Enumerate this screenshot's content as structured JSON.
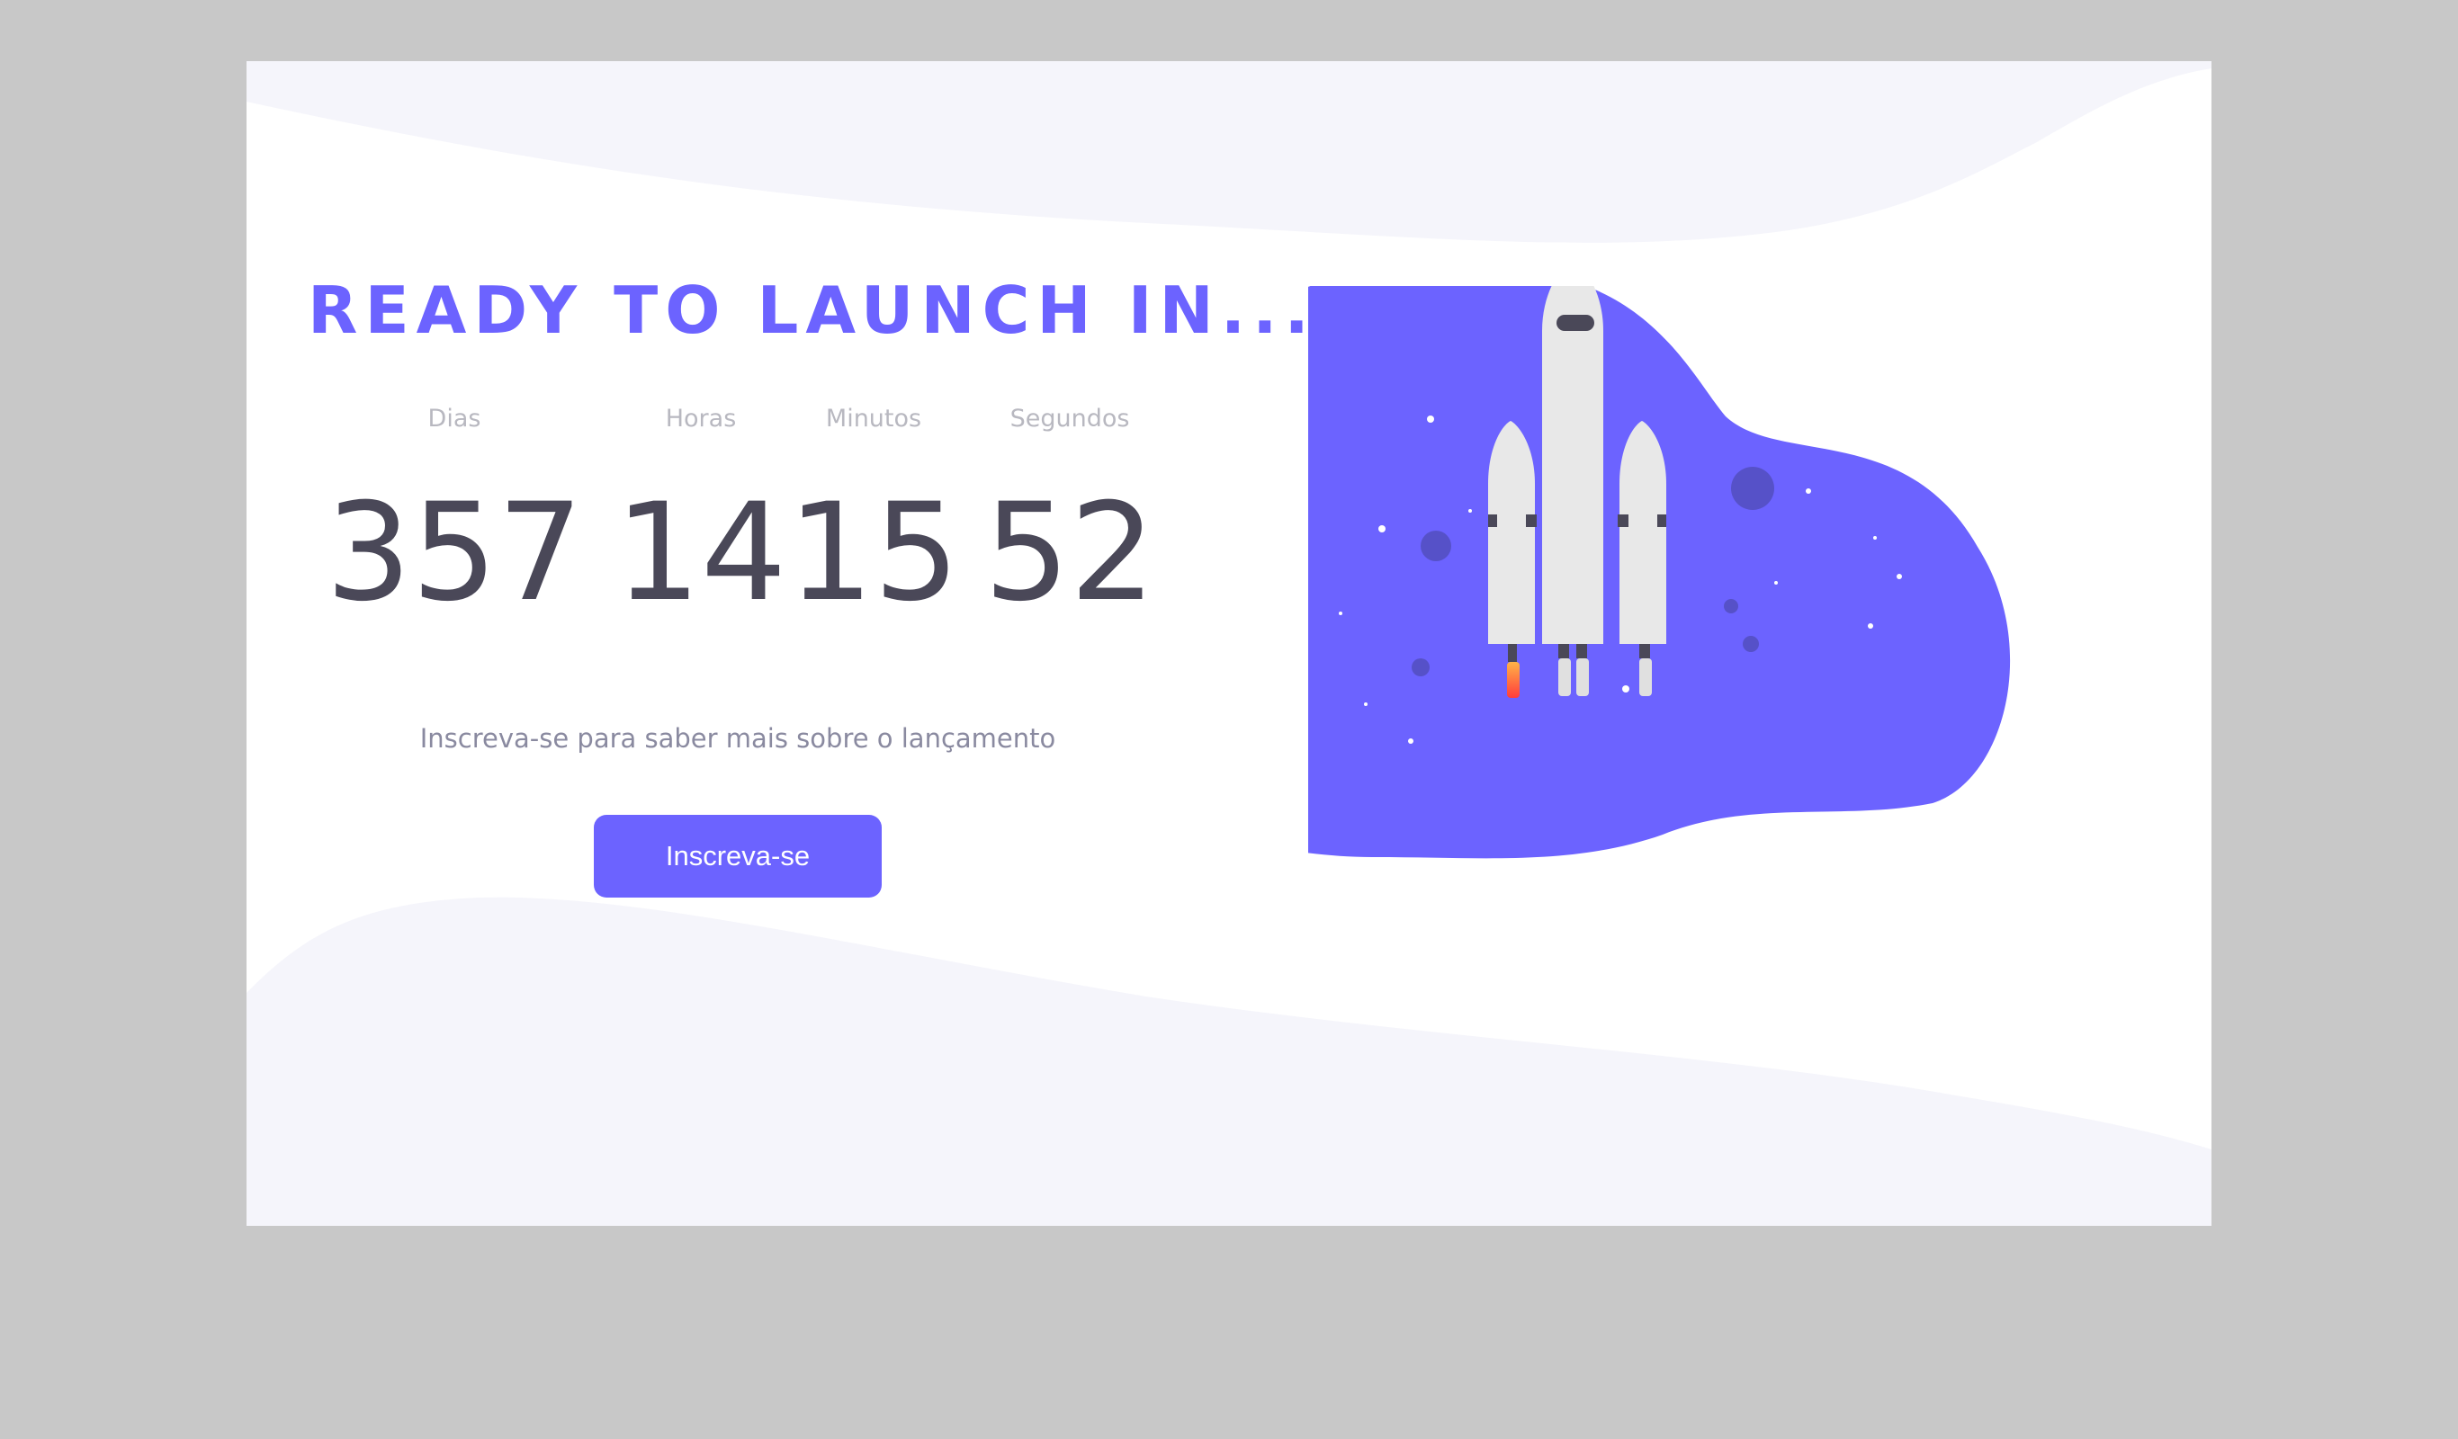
{
  "colors": {
    "accent": "#6c63ff",
    "text_dark": "#4a4858",
    "label_gray": "#b8b8c0",
    "wave": "#f5f5fb",
    "rocket_body": "#e8e8e8",
    "flame": "#ff5a3c"
  },
  "hero": {
    "title": "READY TO LAUNCH IN..."
  },
  "countdown": {
    "days": {
      "label": "Dias",
      "value": "357"
    },
    "hours": {
      "label": "Horas",
      "value": "14"
    },
    "minutes": {
      "label": "Minutos",
      "value": "15"
    },
    "seconds": {
      "label": "Segundos",
      "value": "52"
    }
  },
  "cta": {
    "text": "Inscreva-se para saber mais sobre o lançamento",
    "button_label": "Inscreva-se"
  },
  "illustration": {
    "icon": "rocket-launch-illustration"
  }
}
